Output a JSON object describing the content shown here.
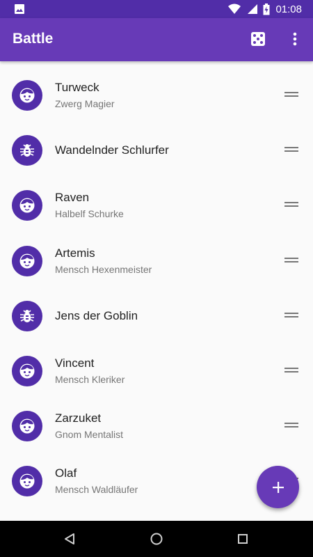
{
  "status_bar": {
    "time": "01:08"
  },
  "app_bar": {
    "title": "Battle"
  },
  "characters": [
    {
      "name": "Turweck",
      "subtitle": "Zwerg Magier",
      "icon": "face-icon"
    },
    {
      "name": "Wandelnder Schlurfer",
      "subtitle": "",
      "icon": "bug-icon"
    },
    {
      "name": "Raven",
      "subtitle": "Halbelf Schurke",
      "icon": "face-icon"
    },
    {
      "name": "Artemis",
      "subtitle": "Mensch Hexenmeister",
      "icon": "face-icon"
    },
    {
      "name": "Jens der Goblin",
      "subtitle": "",
      "icon": "bug-icon"
    },
    {
      "name": "Vincent",
      "subtitle": "Mensch Kleriker",
      "icon": "face-icon"
    },
    {
      "name": "Zarzuket",
      "subtitle": "Gnom Mentalist",
      "icon": "face-icon"
    },
    {
      "name": "Olaf",
      "subtitle": "Mensch Waldläufer",
      "icon": "face-icon"
    }
  ],
  "colors": {
    "primary": "#673ab7",
    "primary_dark": "#512da8"
  }
}
